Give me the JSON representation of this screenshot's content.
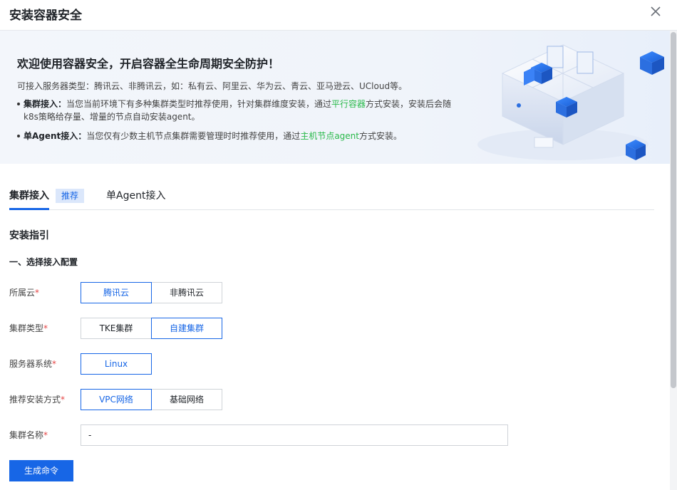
{
  "header": {
    "title": "安装容器安全",
    "close_icon": "close-icon"
  },
  "banner": {
    "title": "欢迎使用容器安全，开启容器全生命周期安全防护！",
    "line1": "可接入服务器类型：腾讯云、非腾讯云，如：私有云、阿里云、华为云、青云、亚马逊云、UCloud等。",
    "bullet1": {
      "bold": "集群接入：",
      "text_a": "当您当前环境下有多种集群类型时推荐使用，针对集群维度安装，通过",
      "link": "平行容器",
      "text_b": "方式安装，安装后会随k8s策略给存量、增量的节点自动安装agent。"
    },
    "bullet2": {
      "bold": "单Agent接入：",
      "text_a": "当您仅有少数主机节点集群需要管理时时推荐使用，通过",
      "link": "主机节点agent",
      "text_b": "方式安装。"
    }
  },
  "tabs": [
    {
      "label": "集群接入",
      "badge": "推荐",
      "active": true
    },
    {
      "label": "单Agent接入",
      "active": false
    }
  ],
  "guide": {
    "section_title": "安装指引",
    "step_title": "一、选择接入配置"
  },
  "form": {
    "cloud": {
      "label": "所属云",
      "options": [
        "腾讯云",
        "非腾讯云"
      ],
      "selected": "腾讯云"
    },
    "cluster_type": {
      "label": "集群类型",
      "options": [
        "TKE集群",
        "自建集群"
      ],
      "selected": "自建集群"
    },
    "server_os": {
      "label": "服务器系统",
      "options": [
        "Linux"
      ],
      "selected": "Linux"
    },
    "install_method": {
      "label": "推荐安装方式",
      "options": [
        "VPC网络",
        "基础网络"
      ],
      "selected": "VPC网络"
    },
    "cluster_name": {
      "label": "集群名称",
      "value": "-"
    },
    "required_mark": "*"
  },
  "generate_button": "生成命令",
  "colors": {
    "primary": "#1766e6",
    "badge_bg": "#dbe7fb",
    "link_green": "#29b94a",
    "required": "#e54545"
  }
}
